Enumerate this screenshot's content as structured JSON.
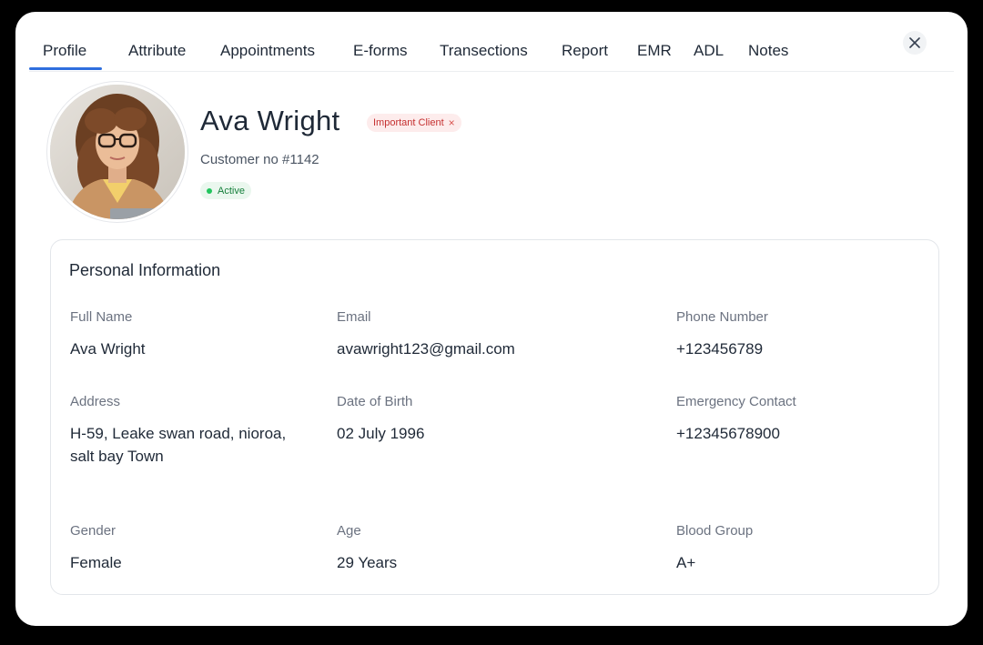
{
  "tabs": [
    {
      "label": "Profile",
      "active": true
    },
    {
      "label": "Attribute",
      "active": false
    },
    {
      "label": "Appointments",
      "active": false
    },
    {
      "label": "E-forms",
      "active": false
    },
    {
      "label": "Transections",
      "active": false
    },
    {
      "label": "Report",
      "active": false
    },
    {
      "label": "EMR",
      "active": false
    },
    {
      "label": "ADL",
      "active": false
    },
    {
      "label": "Notes",
      "active": false
    }
  ],
  "profile": {
    "name": "Ava Wright",
    "tag": "Important Client",
    "tag_remove": "×",
    "customer_no": "Customer no #1142",
    "status": "Active"
  },
  "personal_info": {
    "title": "Personal Information",
    "fields": [
      {
        "label": "Full Name",
        "value": "Ava Wright"
      },
      {
        "label": "Email",
        "value": "avawright123@gmail.com"
      },
      {
        "label": "Phone Number",
        "value": "+123456789"
      },
      {
        "label": "Address",
        "value": "H-59, Leake swan road, nioroa, salt bay Town"
      },
      {
        "label": "Date of Birth",
        "value": "02 July 1996"
      },
      {
        "label": "Emergency Contact",
        "value": "+12345678900"
      },
      {
        "label": "Gender",
        "value": "Female"
      },
      {
        "label": "Age",
        "value": "29 Years"
      },
      {
        "label": "Blood Group",
        "value": "A+"
      }
    ]
  },
  "colors": {
    "accent": "#2f6fde",
    "tag_bg": "#fdecec",
    "tag_text": "#c53030",
    "status_bg": "#eaf7ee",
    "status_text": "#157f3b"
  },
  "icons": {
    "close": "close-icon",
    "status": "status-dot-icon"
  }
}
